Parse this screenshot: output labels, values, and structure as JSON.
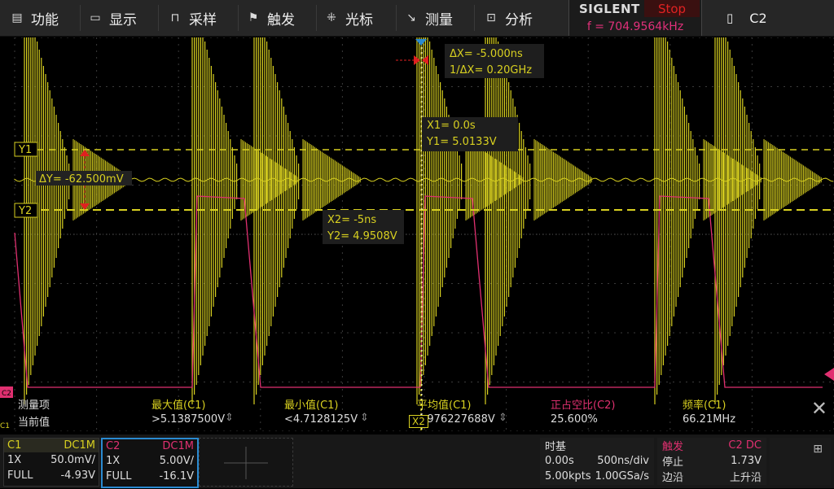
{
  "menu": {
    "items": [
      {
        "label": "功能",
        "icon": "function-icon"
      },
      {
        "label": "显示",
        "icon": "display-icon"
      },
      {
        "label": "采样",
        "icon": "acquire-icon"
      },
      {
        "label": "触发",
        "icon": "trigger-flag-icon"
      },
      {
        "label": "光标",
        "icon": "cursor-icon"
      },
      {
        "label": "测量",
        "icon": "measure-icon"
      },
      {
        "label": "分析",
        "icon": "analysis-icon"
      }
    ]
  },
  "brand": {
    "name": "SIGLENT",
    "status": "Stop",
    "freq": "f = 704.9564kHz"
  },
  "channel_select": {
    "label": "C2"
  },
  "cursors": {
    "dx": "ΔX= -5.000ns",
    "inv_dx": "1/ΔX= 0.20GHz",
    "x1": "X1= 0.0s",
    "y1v": "Y1= 5.0133V",
    "x2": "X2= -5ns",
    "y2v": "Y2= 4.9508V",
    "dy": "ΔY= -62.500mV",
    "y1_tag": "Y1",
    "y2_tag": "Y2",
    "x2_tag": "X2"
  },
  "measure": {
    "row1_label": "测量项",
    "row2_label": "当前值",
    "items": [
      {
        "name": "最大值(C1)",
        "value": ">5.1387500V",
        "color": "#d8d020"
      },
      {
        "name": "最小值(C1)",
        "value": "<4.7128125V",
        "color": "#d8d020"
      },
      {
        "name": "平均值(C1)",
        "value": "4.976227688V",
        "color": "#d8d020"
      },
      {
        "name": "正占空比(C2)",
        "value": "25.600%",
        "color": "#e03070"
      },
      {
        "name": "频率(C1)",
        "value": "66.21MHz",
        "color": "#d8d020"
      }
    ]
  },
  "channels": {
    "c1": {
      "name": "C1",
      "coupling": "DC1M",
      "probe": "1X",
      "scale": "50.0mV/",
      "bw": "FULL",
      "offset": "-4.93V"
    },
    "c2": {
      "name": "C2",
      "coupling": "DC1M",
      "probe": "1X",
      "scale": "5.00V/",
      "bw": "FULL",
      "offset": "-16.1V"
    }
  },
  "timebase": {
    "title": "时基",
    "delay": "0.00s",
    "scale": "500ns/div",
    "points": "5.00kpts",
    "rate": "1.00GSa/s"
  },
  "trigger": {
    "title": "触发",
    "source": "C2 DC",
    "state": "停止",
    "level": "1.73V",
    "type": "边沿",
    "slope": "上升沿"
  },
  "colors": {
    "c1": "#d8d020",
    "c2": "#e03070",
    "grid": "#444444",
    "accent": "#2a8ad0"
  }
}
